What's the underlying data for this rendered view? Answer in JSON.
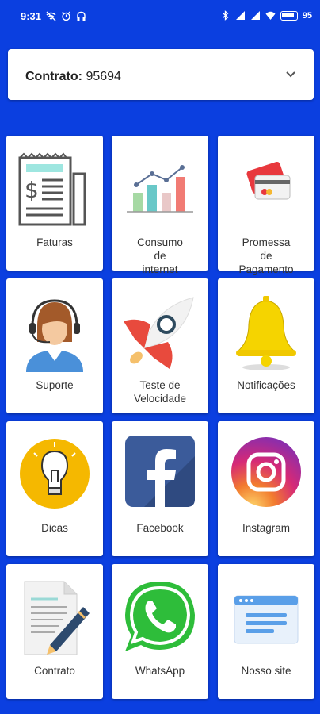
{
  "status_bar": {
    "time": "9:31",
    "battery": "95"
  },
  "contract": {
    "label": "Contrato:",
    "value": "95694"
  },
  "tiles": [
    {
      "label": "Faturas"
    },
    {
      "label": "Consumo\nde\ninternet"
    },
    {
      "label": "Promessa\nde\nPagamento"
    },
    {
      "label": "Suporte"
    },
    {
      "label": "Teste de\nVelocidade"
    },
    {
      "label": "Notificações"
    },
    {
      "label": "Dicas"
    },
    {
      "label": "Facebook"
    },
    {
      "label": "Instagram"
    },
    {
      "label": "Contrato"
    },
    {
      "label": "WhatsApp"
    },
    {
      "label": "Nosso site"
    }
  ],
  "colors": {
    "background": "#0b3fe0",
    "card": "#ffffff"
  }
}
